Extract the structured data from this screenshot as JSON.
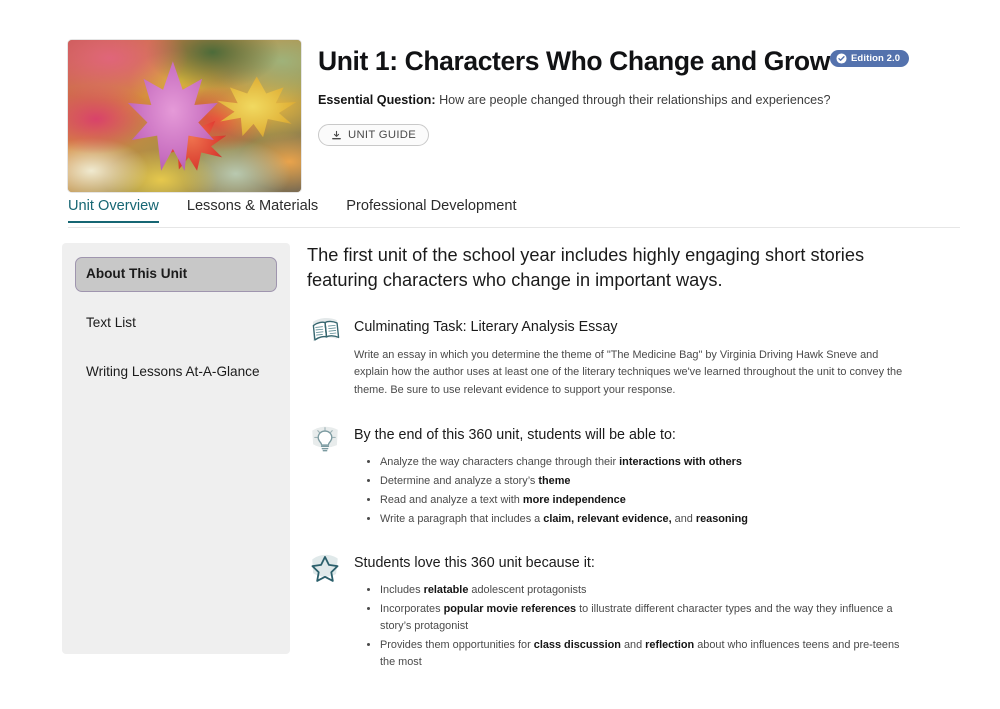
{
  "header": {
    "thumbnail_alt": "autumn-leaves-photo",
    "title": "Unit 1: Characters Who Change and Grow",
    "edition_badge": "Edition 2.0",
    "edition_badge_color": "#5472ad",
    "essential_question_label": "Essential Question:",
    "essential_question_text": " How are people changed through their relationships and experiences?",
    "unit_guide_button": "UNIT GUIDE",
    "download_icon": "download-icon",
    "check_icon": "check-circle-icon"
  },
  "tabs": {
    "active_color": "#166673",
    "items": [
      {
        "label": "Unit Overview",
        "active": true
      },
      {
        "label": "Lessons & Materials",
        "active": false
      },
      {
        "label": "Professional Development",
        "active": false
      }
    ]
  },
  "sidebar": {
    "background": "#efefef",
    "items": [
      {
        "label": "About This Unit",
        "active": true
      },
      {
        "label": "Text List",
        "active": false
      },
      {
        "label": "Writing Lessons At-A-Glance",
        "active": false
      }
    ]
  },
  "main": {
    "lede": "The first unit of the school year includes highly engaging short stories featuring characters who change in important ways.",
    "sections": [
      {
        "icon": "open-book-icon",
        "title": "Culminating Task: Literary Analysis Essay",
        "kind": "paragraph",
        "paragraph_parts": [
          {
            "text": "Write an essay in which you determine the theme of \"The Medicine Bag\" by Virginia Driving Hawk Sneve and explain how the author uses at least one of the literary techniques we've learned throughout the unit to convey the theme. Be sure to use relevant evidence to support your response.",
            "bold": false
          }
        ]
      },
      {
        "icon": "lightbulb-icon",
        "title": "By the end of this 360 unit, students will be able to:",
        "kind": "list",
        "items": [
          [
            {
              "text": "Analyze the way characters change through their ",
              "bold": false
            },
            {
              "text": "interactions with others",
              "bold": true
            }
          ],
          [
            {
              "text": "Determine and analyze a story’s ",
              "bold": false
            },
            {
              "text": "theme",
              "bold": true
            }
          ],
          [
            {
              "text": "Read and analyze a text with ",
              "bold": false
            },
            {
              "text": "more independence",
              "bold": true
            }
          ],
          [
            {
              "text": "Write a paragraph that includes a ",
              "bold": false
            },
            {
              "text": "claim, relevant evidence,",
              "bold": true
            },
            {
              "text": " and ",
              "bold": false
            },
            {
              "text": "reasoning",
              "bold": true
            }
          ]
        ]
      },
      {
        "icon": "star-icon",
        "title": "Students love this 360 unit because it:",
        "kind": "list",
        "items": [
          [
            {
              "text": "Includes ",
              "bold": false
            },
            {
              "text": "relatable",
              "bold": true
            },
            {
              "text": " adolescent protagonists",
              "bold": false
            }
          ],
          [
            {
              "text": "Incorporates ",
              "bold": false
            },
            {
              "text": "popular movie references",
              "bold": true
            },
            {
              "text": " to illustrate different character types and the way they influence a story’s protagonist",
              "bold": false
            }
          ],
          [
            {
              "text": "Provides them opportunities for ",
              "bold": false
            },
            {
              "text": "class discussion",
              "bold": true
            },
            {
              "text": " and ",
              "bold": false
            },
            {
              "text": "reflection",
              "bold": true
            },
            {
              "text": " about who influences teens and pre-teens the most",
              "bold": false
            }
          ]
        ]
      }
    ]
  }
}
